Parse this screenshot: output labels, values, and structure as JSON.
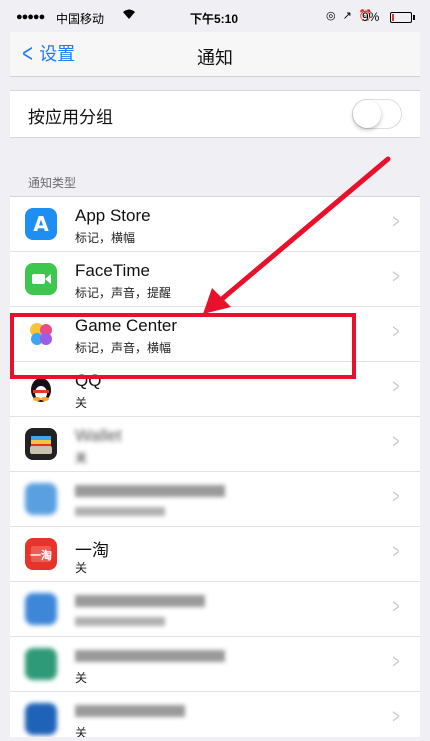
{
  "status_bar": {
    "signal": "●●●●●",
    "carrier": "中国移动",
    "wifi": "wifi-icon",
    "time": "下午5:10",
    "indicators": "◎ ↗ ⏰",
    "battery_percent": "9%",
    "battery_level": 0.09
  },
  "nav": {
    "back_label": "设置",
    "title": "通知"
  },
  "group_by_app": {
    "label": "按应用分组",
    "on": false
  },
  "section_header": "通知类型",
  "apps": [
    {
      "name": "App Store",
      "sub": "标记，横幅",
      "icon": "app-store-icon",
      "color": "#1e8ff2"
    },
    {
      "name": "FaceTime",
      "sub": "标记，声音，提醒",
      "icon": "facetime-icon",
      "color": "#3ec74e"
    },
    {
      "name": "Game Center",
      "sub": "标记，声音，横幅",
      "icon": "game-center-icon",
      "color": "#ffffff"
    },
    {
      "name": "QQ",
      "sub": "关",
      "icon": "qq-penguin-icon",
      "color": "#ffffff"
    },
    {
      "name": "Wallet",
      "sub": "关",
      "icon": "wallet-icon",
      "color": "#222222"
    },
    {
      "name": "",
      "sub": "",
      "icon": "blurred-app-icon",
      "color": "#5aa0e0"
    },
    {
      "name": "一淘",
      "sub": "关",
      "icon": "yitao-icon",
      "color": "#e8332a"
    },
    {
      "name": "",
      "sub": "",
      "icon": "blurred-app-icon",
      "color": "#3d86d8"
    },
    {
      "name": "",
      "sub": "关",
      "icon": "blurred-app-icon",
      "color": "#2f9a78"
    },
    {
      "name": "",
      "sub": "关",
      "icon": "blurred-app-icon",
      "color": "#1f63b8"
    }
  ],
  "annotation": {
    "highlight_color": "#e8102a"
  }
}
